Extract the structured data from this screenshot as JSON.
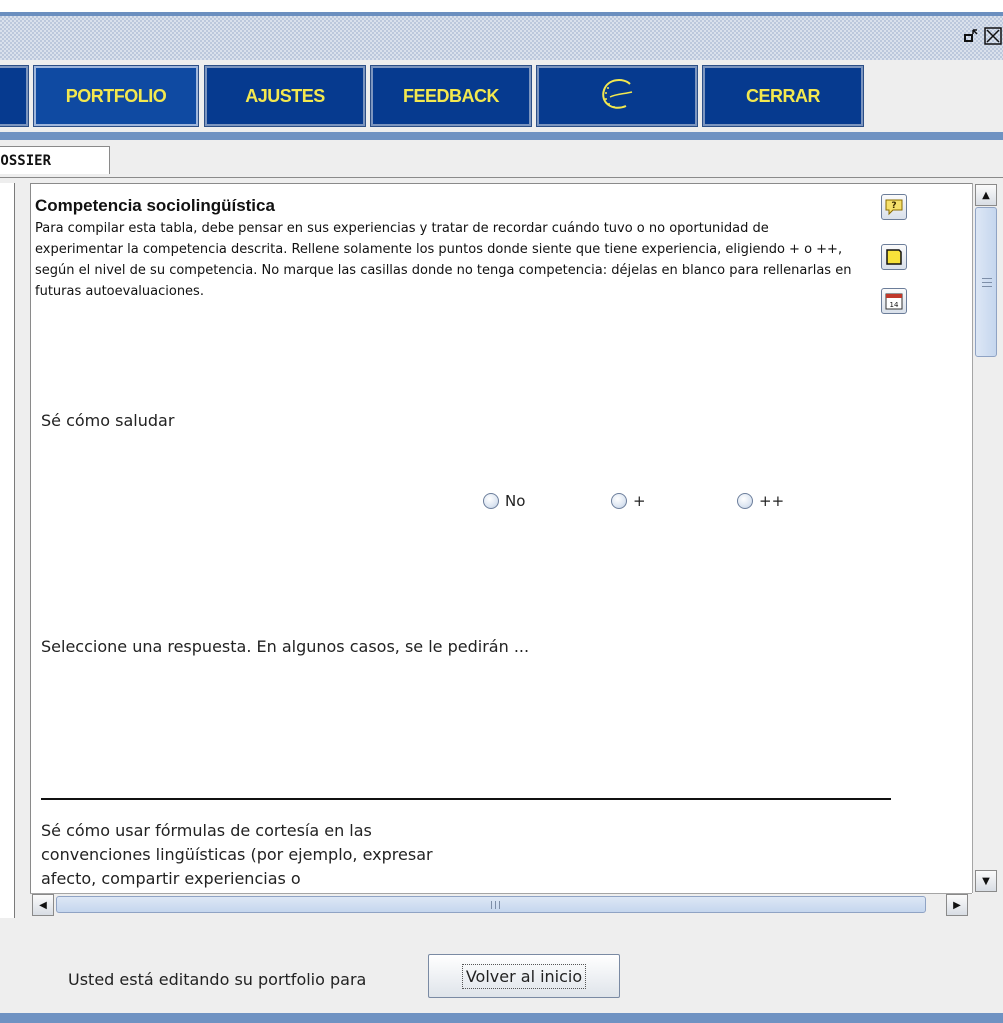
{
  "nav": {
    "items": [
      {
        "label": "PORTFOLIO",
        "active": true
      },
      {
        "label": "AJUSTES",
        "active": false
      },
      {
        "label": "FEEDBACK",
        "active": false
      },
      {
        "label": "",
        "icon": "council-of-europe-logo-icon"
      },
      {
        "label": "CERRAR",
        "active": false
      }
    ]
  },
  "tabs": {
    "active": "DOSSIER"
  },
  "content": {
    "heading": "Competencia sociolingüística",
    "intro": "Para compilar esta tabla, debe pensar en sus experiencias y tratar de recordar cuándo tuvo o no oportunidad de experimentar la competencia descrita. Rellene solamente los puntos donde siente que tiene experiencia, eligiendo + o ++, según el nivel de su competencia. No marque las casillas donde no tenga competencia: déjelas en blanco para rellenarlas en futuras autoevaluaciones.",
    "question1": "Sé cómo saludar",
    "options": {
      "no": "No",
      "plus": "+",
      "plusplus": "++"
    },
    "hint": "Seleccione una respuesta. En algunos casos, se le pedirán ...",
    "question2": "Sé cómo usar fórmulas de cortesía en las convenciones lingüísticas (por ejemplo, expresar afecto, compartir experiencias o"
  },
  "footer": {
    "label": "Usted está editando su portfolio para",
    "back_button": "Volver al inicio"
  },
  "colors": {
    "nav_bg": "#063a8f",
    "nav_text": "#f3e84f",
    "accent_bar": "#6f92c2"
  },
  "icons": [
    "restore-icon",
    "close-icon",
    "help-icon",
    "note-icon",
    "calendar-icon"
  ]
}
